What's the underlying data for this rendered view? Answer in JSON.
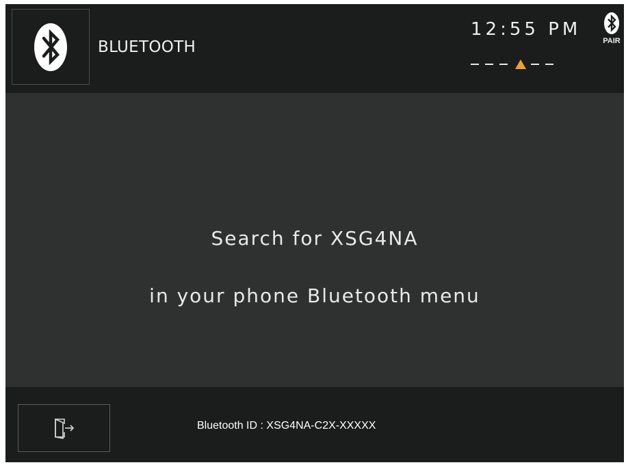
{
  "header": {
    "title": "BLUETOOTH",
    "clock": "12:55 PM",
    "pair_label": "PAIR",
    "icons": {
      "main": "bluetooth-icon",
      "status": "bluetooth-pair-icon",
      "signal": "signal-indicator-icon"
    }
  },
  "message": {
    "line1": "Search for XSG4NA",
    "line2": "in your phone Bluetooth menu"
  },
  "footer": {
    "bluetooth_id": "Bluetooth ID : XSG4NA-C2X-XXXXX",
    "exit_icon": "exit-icon"
  },
  "colors": {
    "background": "#2f3131",
    "bar": "#1b1c1c",
    "text": "#eeeeee",
    "accent": "#f0a030"
  }
}
